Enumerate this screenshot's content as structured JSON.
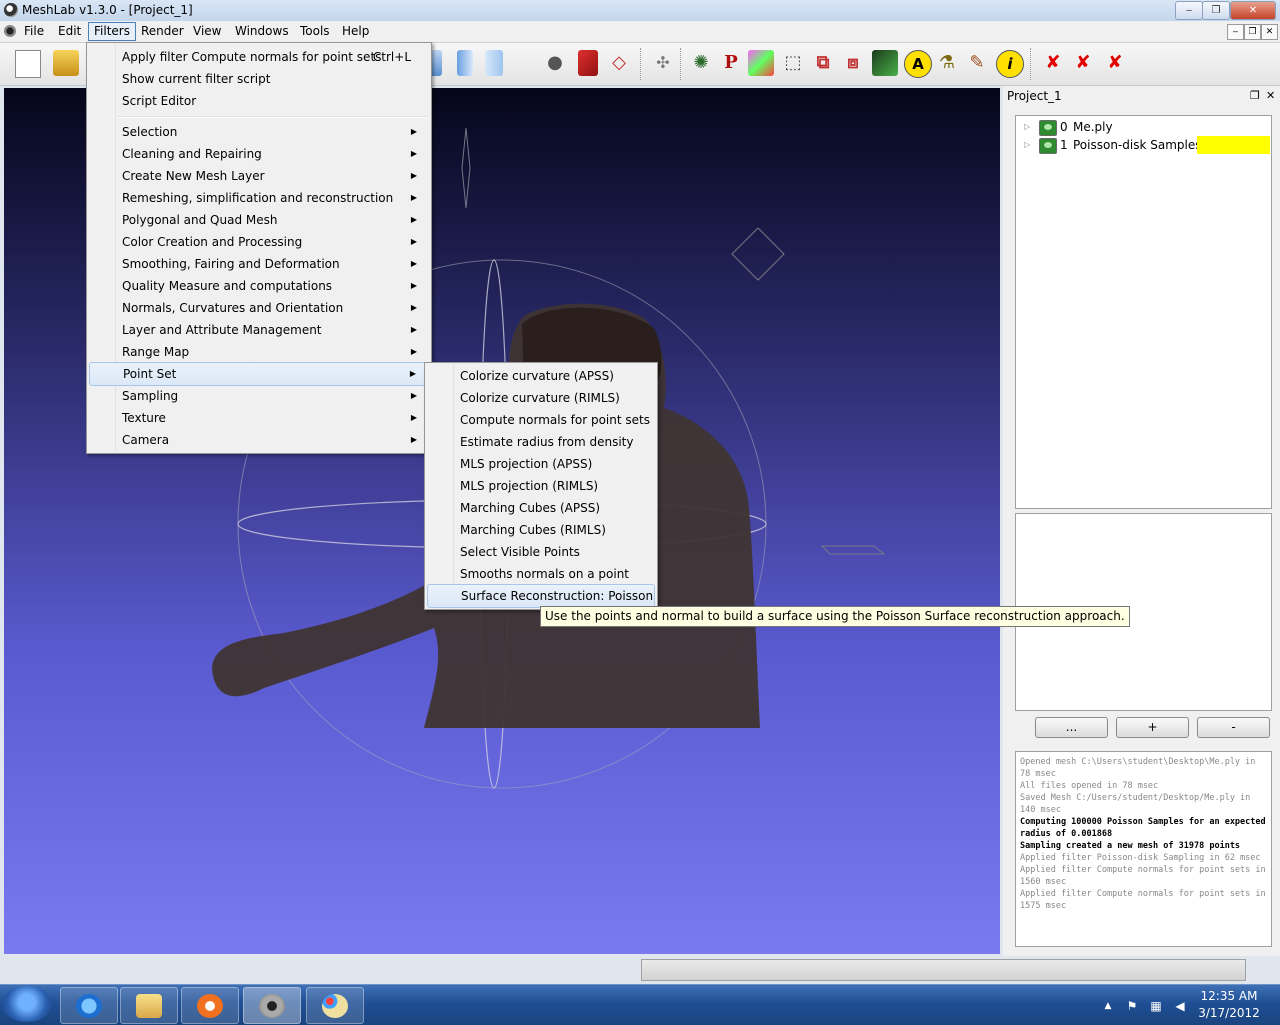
{
  "window": {
    "title": "MeshLab v1.3.0 - [Project_1]",
    "controls": {
      "minimize": "‒",
      "maximize": "❐",
      "close": "✕"
    }
  },
  "menubar": {
    "items": [
      "File",
      "Edit",
      "Filters",
      "Render",
      "View",
      "Windows",
      "Tools",
      "Help"
    ],
    "active": "Filters",
    "mdi_controls": [
      "‒",
      "❐",
      "✕"
    ]
  },
  "filters_menu": {
    "top_items": [
      {
        "label": "Apply filter Compute normals for point sets",
        "shortcut": "Ctrl+L"
      },
      {
        "label": "Show current filter script"
      },
      {
        "label": "Script Editor"
      }
    ],
    "submenus": [
      "Selection",
      "Cleaning and Repairing",
      "Create New Mesh Layer",
      "Remeshing, simplification and reconstruction",
      "Polygonal and Quad Mesh",
      "Color Creation and Processing",
      "Smoothing, Fairing and Deformation",
      "Quality Measure and computations",
      "Normals, Curvatures and Orientation",
      "Layer and Attribute Management",
      "Range Map",
      "Point Set",
      "Sampling",
      "Texture",
      "Camera"
    ],
    "highlighted": "Point Set"
  },
  "point_set_submenu": {
    "items": [
      "Colorize curvature (APSS)",
      "Colorize curvature (RIMLS)",
      "Compute normals for point sets",
      "Estimate radius from density",
      "MLS projection (APSS)",
      "MLS projection (RIMLS)",
      "Marching Cubes (APSS)",
      "Marching Cubes (RIMLS)",
      "Select Visible Points",
      "Smooths normals on a point sets",
      "Surface Reconstruction: Poisson"
    ],
    "highlighted": "Surface Reconstruction: Poisson"
  },
  "tooltip": "Use the points and normal to build a surface using the Poisson Surface reconstruction approach.",
  "layer_panel": {
    "title": "Project_1",
    "float_icon": "❐",
    "close_icon": "✕",
    "layers": [
      {
        "index": "0",
        "name": "Me.ply"
      },
      {
        "index": "1",
        "name": "Poisson-disk Samples *"
      }
    ],
    "buttons": [
      "...",
      "+",
      "-"
    ]
  },
  "log": [
    {
      "text": "Opened mesh C:\\Users\\student\\Desktop\\Me.ply in 78 msec",
      "bold": false
    },
    {
      "text": "All files opened in 78 msec",
      "bold": false
    },
    {
      "text": "Saved Mesh C:/Users/student/Desktop/Me.ply in 140 msec",
      "bold": false
    },
    {
      "text": "Computing 100000 Poisson Samples for an expected radius of 0.001868",
      "bold": true
    },
    {
      "text": "Sampling created a new mesh of 31978 points",
      "bold": true
    },
    {
      "text": "Applied filter Poisson-disk Sampling in 62 msec",
      "bold": false
    },
    {
      "text": "Applied filter Compute normals for point sets in 1560 msec",
      "bold": false
    },
    {
      "text": "Applied filter Compute normals for point sets in 1575 msec",
      "bold": false
    }
  ],
  "taskbar": {
    "apps": [
      "internet-explorer",
      "windows-explorer",
      "media-player",
      "meshlab",
      "paint"
    ],
    "active_app": "meshlab",
    "clock_time": "12:35 AM",
    "clock_date": "3/17/2012",
    "tray_icons": [
      "▲",
      "flag",
      "network",
      "volume"
    ]
  },
  "colors": {
    "viewport_top": "#05061a",
    "viewport_bottom": "#7a7af0",
    "highlight_yellow": "#ffff00",
    "taskbar": "#1f4f95"
  }
}
